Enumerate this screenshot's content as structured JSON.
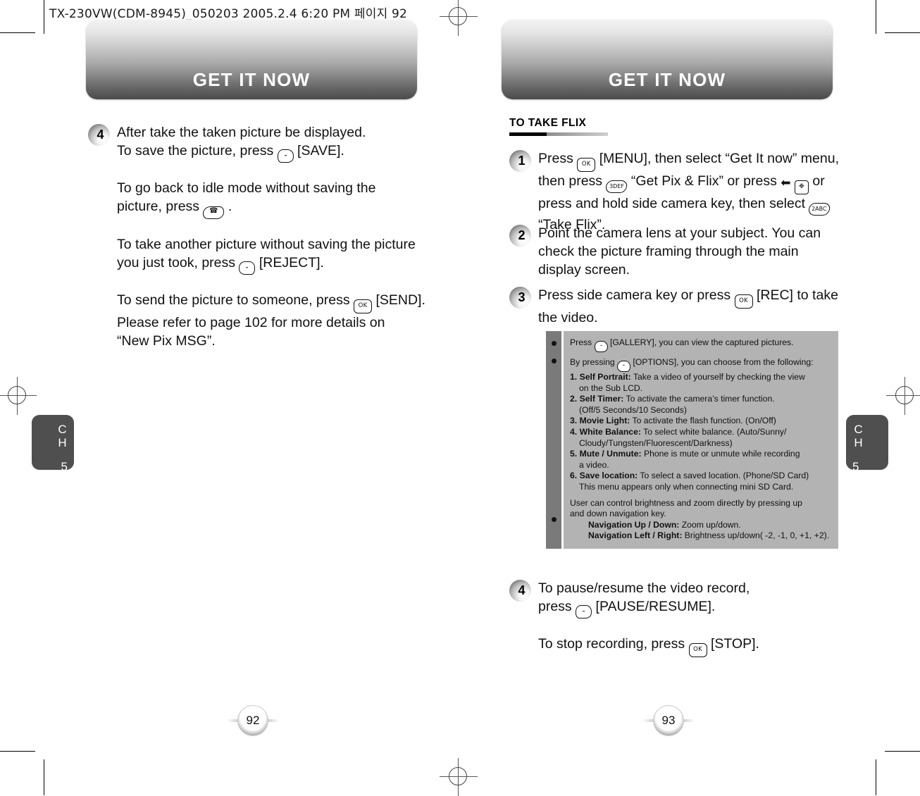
{
  "print_slug": "TX-230VW(CDM-8945)_050203  2005.2.4 6:20 PM  페이지 92",
  "colors": {
    "banner_top": "#f2f2f2",
    "banner_bottom": "#4b4b4b",
    "note_panel": "#b3b3b3",
    "note_strip": "#7a7a7a",
    "chapter_tab": "#4f4f4f"
  },
  "left_page": {
    "banner_title": "GET IT NOW",
    "folio": "92",
    "chapter_tab": {
      "label": "CH",
      "number": "5"
    },
    "step": {
      "number": "4",
      "line1": "After take the taken picture be displayed.",
      "line2_a": "To save the picture, press",
      "line2_key": "-",
      "line2_b": "[SAVE].",
      "para2_a": "To go back to idle mode without saving the",
      "para2_b": "picture, press",
      "para2_c": ".",
      "para3_a": "To take another picture without saving the picture",
      "para3_b": "you just took, press",
      "para3_key": "-",
      "para3_c": "[REJECT].",
      "para4_a": "To send the picture to someone, press",
      "para4_key": "OK",
      "para4_b": "[SEND].",
      "para4_c": "Please refer to page 102 for more details on",
      "para4_d": "“New Pix MSG”."
    }
  },
  "right_page": {
    "banner_title": "GET IT NOW",
    "folio": "93",
    "chapter_tab": {
      "label": "CH",
      "number": "5"
    },
    "section_heading": "TO TAKE FLIX",
    "steps": [
      {
        "number": "1",
        "t1": "Press",
        "k1": "OK",
        "t2": "[MENU], then select “Get It now” menu,",
        "t3": "then press",
        "k2": "3DEF",
        "t4": "“Get Pix & Flix” or press",
        "k3": "nav-pad",
        "t5": "or",
        "t6": "press and hold side camera key, then select",
        "k4": "2ABC",
        "t7": "“Take Flix”."
      },
      {
        "number": "2",
        "t1": "Point the camera lens at your subject. You can",
        "t2": "check the picture framing through the main",
        "t3": "display screen."
      },
      {
        "number": "3",
        "t1": "Press side camera key or press",
        "k1": "OK",
        "t2": "[REC] to take",
        "t3": "the video."
      },
      {
        "number": "4",
        "t1": "To pause/resume the video record,",
        "t2": "press",
        "k1": "-",
        "t3": "[PAUSE/RESUME].",
        "t4": "To stop recording, press",
        "k2": "OK",
        "t5": "[STOP]."
      }
    ],
    "note_box": {
      "bullet1_a": "Press",
      "bullet1_key": "-",
      "bullet1_b": "[GALLERY], you can view the captured pictures.",
      "bullet2_a": "By pressing",
      "bullet2_key": "-",
      "bullet2_b": "[OPTIONS], you can choose from the following:",
      "options": [
        {
          "n": "1.",
          "title": "Self Portrait:",
          "text": "Take a video of yourself by checking the view",
          "cont": "on the Sub LCD."
        },
        {
          "n": "2.",
          "title": "Self Timer:",
          "text": "To activate the camera’s timer function.",
          "cont": "(Off/5 Seconds/10 Seconds)"
        },
        {
          "n": "3.",
          "title": "Movie Light:",
          "text": "To activate the flash function. (On/Off)",
          "cont": ""
        },
        {
          "n": "4.",
          "title": "White Balance:",
          "text": "To select white balance. (Auto/Sunny/",
          "cont": "Cloudy/Tungsten/Fluorescent/Darkness)"
        },
        {
          "n": "5.",
          "title": "Mute / Unmute:",
          "text": "Phone is mute or unmute while recording",
          "cont": "a video."
        },
        {
          "n": "6.",
          "title": "Save location:",
          "text": "To select a saved location. (Phone/SD Card)",
          "cont": "This menu appears only when connecting mini SD Card."
        }
      ],
      "bullet3_a": "User can control brightness and zoom directly by pressing up",
      "bullet3_b": "and down navigation key.",
      "nav_updown_title": "Navigation Up / Down:",
      "nav_updown_text": "Zoom up/down.",
      "nav_lr_title": "Navigation Left / Right:",
      "nav_lr_text": "Brightness up/down( -2, -1, 0, +1, +2)."
    }
  }
}
